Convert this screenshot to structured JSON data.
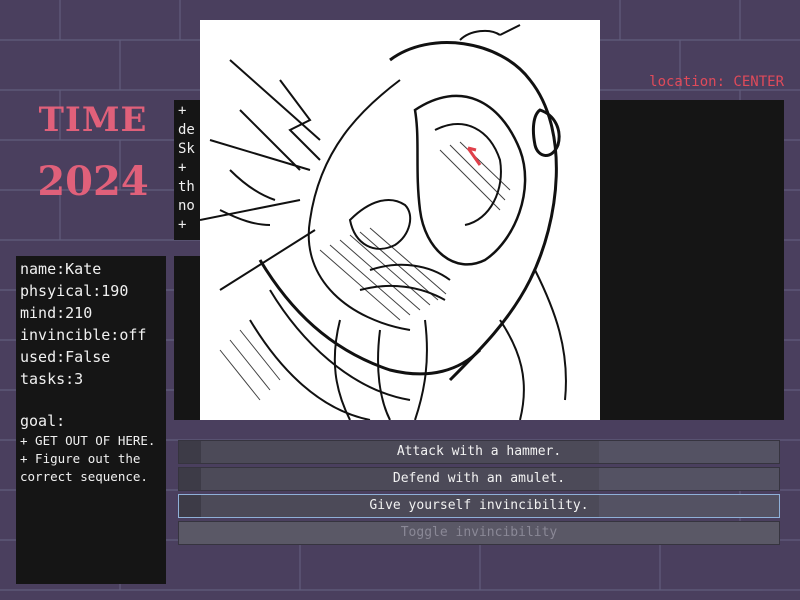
{
  "time": {
    "label": "TIME",
    "year": "2024"
  },
  "location": "location: CENTER",
  "side_log": [
    "+",
    "de",
    "Sk",
    "+",
    "th",
    "no",
    "+"
  ],
  "stats": [
    "name:Kate",
    "phsyical:190",
    "mind:210",
    "invincible:off",
    "used:False",
    "tasks:3"
  ],
  "goal": {
    "title": "goal:",
    "items": [
      "+ GET OUT OF HERE.",
      "+ Figure out the correct sequence."
    ]
  },
  "actions": [
    {
      "label": "Attack with a hammer.",
      "state": "normal"
    },
    {
      "label": "Defend with an amulet.",
      "state": "normal"
    },
    {
      "label": "Give yourself invincibility.",
      "state": "selected"
    },
    {
      "label": "Toggle invincibility",
      "state": "disabled"
    }
  ],
  "colors": {
    "accent": "#e0607a",
    "location": "#e04a5a",
    "panel": "#151515",
    "background": "#4a3f5e"
  },
  "icons": [
    "monster-illustration"
  ]
}
